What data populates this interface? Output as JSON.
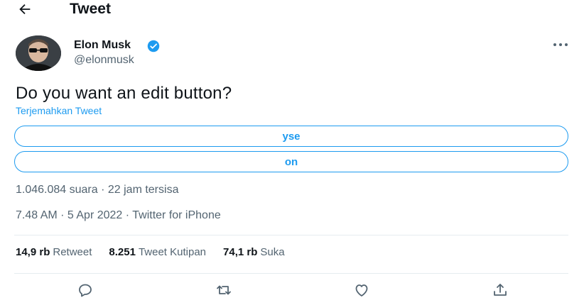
{
  "header": {
    "title": "Tweet",
    "back_icon": "back-arrow-icon"
  },
  "author": {
    "name": "Elon Musk",
    "handle": "@elonmusk",
    "verified": true,
    "avatar_icon": "avatar"
  },
  "tweet": {
    "text": "Do you want an edit button?",
    "translate_label": "Terjemahkan Tweet"
  },
  "poll": {
    "options": [
      "yse",
      "on"
    ],
    "meta": "1.046.084 suara · 22 jam tersisa"
  },
  "timestamp": "7.48 AM · 5 Apr 2022 · Twitter for iPhone",
  "stats": {
    "retweets": {
      "count": "14,9 rb",
      "label": "Retweet"
    },
    "quotes": {
      "count": "8.251",
      "label": "Tweet Kutipan"
    },
    "likes": {
      "count": "74,1 rb",
      "label": "Suka"
    }
  },
  "actions": [
    "reply-icon",
    "retweet-icon",
    "like-icon",
    "share-icon"
  ],
  "colors": {
    "accent": "#1d9bf0",
    "text": "#0f1419",
    "secondary": "#536471",
    "divider": "#e6ecf0"
  }
}
